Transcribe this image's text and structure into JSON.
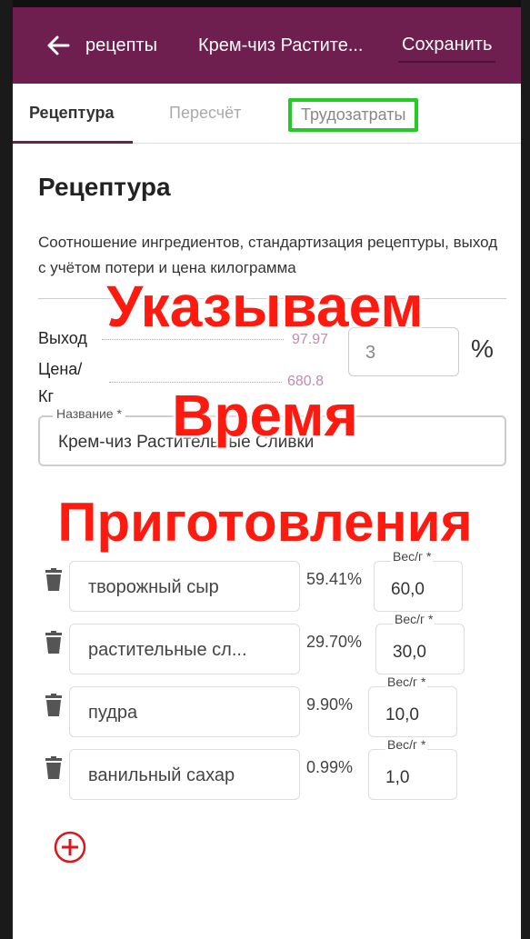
{
  "appbar": {
    "breadcrumb": "рецепты",
    "title": "Крем-чиз Растите...",
    "save_label": "Сохранить",
    "color": "#6e1f4f"
  },
  "tabs": [
    {
      "label": "Рецептура",
      "active": true
    },
    {
      "label": "Пересчёт",
      "active": false
    },
    {
      "label": "Трудозатраты",
      "active": false,
      "highlighted": true
    }
  ],
  "section": {
    "title": "Рецептура",
    "description": "Соотношение ингредиентов, стандартизация рецептуры, выход с учётом потери и цена килограмма"
  },
  "yield": {
    "label": "Выход",
    "value": "97.97",
    "loss_value": "3",
    "unit": "%"
  },
  "price": {
    "label_line1": "Цена/",
    "label_line2": "Кг",
    "value": "680.8"
  },
  "name_field": {
    "label": "Название *",
    "value": "Крем-чиз Растительные Сливки"
  },
  "ingredients": [
    {
      "name": "творожный сыр",
      "percent": "59.41%",
      "weight_label": "Вес/г *",
      "weight": "60,0"
    },
    {
      "name": "растительные сл...",
      "percent": "29.70%",
      "weight_label": "Вес/г *",
      "weight": "30,0"
    },
    {
      "name": "пудра",
      "percent": "9.90%",
      "weight_label": "Вес/г *",
      "weight": "10,0"
    },
    {
      "name": "ванильный сахар",
      "percent": "0.99%",
      "weight_label": "Вес/г *",
      "weight": "1,0"
    }
  ],
  "icons": {
    "back": "arrow-left-icon",
    "delete": "trash-icon",
    "add": "plus-circle-icon"
  },
  "overlay": {
    "line1": "Указываем",
    "line2": "Время",
    "line3": "Приготовления",
    "color": "#ff1a0f"
  }
}
